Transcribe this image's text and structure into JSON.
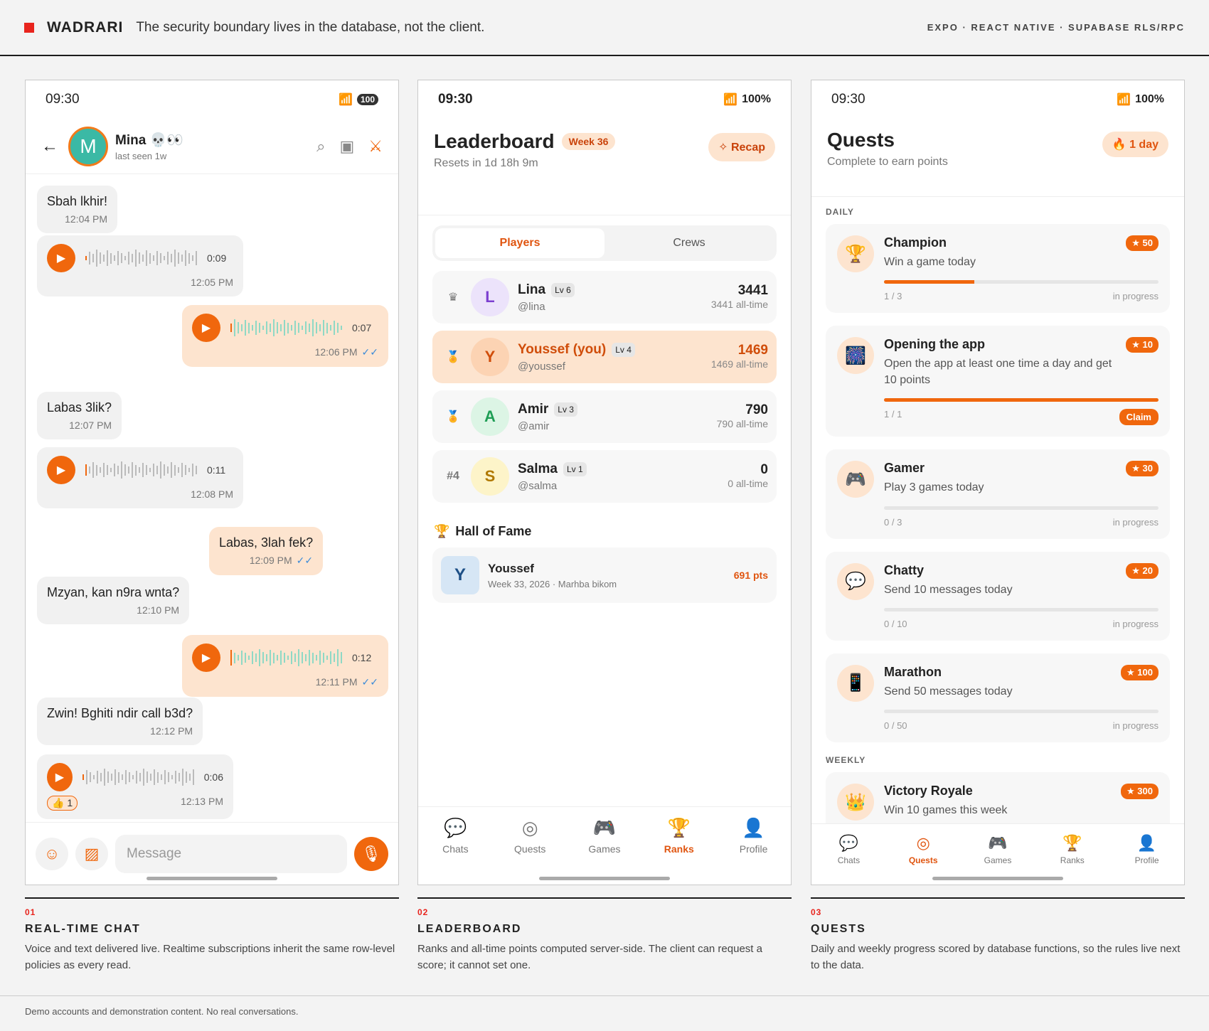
{
  "header": {
    "brand": "WADRARI",
    "tagline": "The security boundary lives in the database, not the client.",
    "stack": "EXPO · REACT NATIVE · SUPABASE RLS/RPC"
  },
  "chat": {
    "time": "09:30",
    "battery": "100",
    "contact_name": "Mina 💀👀",
    "contact_initial": "M",
    "last_seen": "last seen 1w",
    "input_placeholder": "Message",
    "messages": [
      {
        "text": "Sbah lkhir!",
        "time": "12:04 PM"
      },
      {
        "duration": "0:09",
        "time": "12:05 PM"
      },
      {
        "duration": "0:07",
        "time": "12:06 PM"
      },
      {
        "text": "Labas 3lik?",
        "time": "12:07 PM"
      },
      {
        "duration": "0:11",
        "time": "12:08 PM"
      },
      {
        "text": "Labas, 3lah fek?",
        "time": "12:09 PM"
      },
      {
        "text": "Mzyan, kan n9ra wnta?",
        "time": "12:10 PM"
      },
      {
        "duration": "0:12",
        "time": "12:11 PM"
      },
      {
        "text": "Zwin! Bghiti ndir call b3d?",
        "time": "12:12 PM"
      },
      {
        "duration": "0:06",
        "time": "12:13 PM",
        "reaction": "👍 1"
      }
    ]
  },
  "leaderboard": {
    "time": "09:30",
    "battery": "100%",
    "title": "Leaderboard",
    "week": "Week 36",
    "resets": "Resets in 1d 18h 9m",
    "recap": "Recap",
    "tabs": [
      "Players",
      "Crews"
    ],
    "rows": [
      {
        "rank": "",
        "name": "Lina",
        "level": "Lv 6",
        "handle": "@lina",
        "points": "3441",
        "alltime": "3441 all-time",
        "initial": "L"
      },
      {
        "rank": "",
        "name": "Youssef (you)",
        "level": "Lv 4",
        "handle": "@youssef",
        "points": "1469",
        "alltime": "1469 all-time",
        "initial": "Y"
      },
      {
        "rank": "",
        "name": "Amir",
        "level": "Lv 3",
        "handle": "@amir",
        "points": "790",
        "alltime": "790 all-time",
        "initial": "A"
      },
      {
        "rank": "#4",
        "name": "Salma",
        "level": "Lv 1",
        "handle": "@salma",
        "points": "0",
        "alltime": "0 all-time",
        "initial": "S"
      }
    ],
    "hof_title": "Hall of Fame",
    "hof": {
      "initial": "Y",
      "name": "Youssef",
      "meta": "Week 33, 2026 · Marhba bikom",
      "points": "691 pts"
    },
    "nav": [
      "Chats",
      "Quests",
      "Games",
      "Ranks",
      "Profile"
    ]
  },
  "quests": {
    "time": "09:30",
    "battery": "100%",
    "title": "Quests",
    "subtitle": "Complete to earn points",
    "streak": "1 day",
    "daily_label": "DAILY",
    "weekly_label": "WEEKLY",
    "items": [
      {
        "icon": "🏆",
        "name": "Champion",
        "desc": "Win a game today",
        "points": "50",
        "progress": "1 / 3",
        "status": "in progress",
        "fraction": 0.33
      },
      {
        "icon": "🎆",
        "name": "Opening the app",
        "desc": "Open the app at least one time a day and get 10 points",
        "points": "10",
        "progress": "1 / 1",
        "status": "Claim",
        "fraction": 1
      },
      {
        "icon": "🎮",
        "name": "Gamer",
        "desc": "Play 3 games today",
        "points": "30",
        "progress": "0 / 3",
        "status": "in progress",
        "fraction": 0
      },
      {
        "icon": "💬",
        "name": "Chatty",
        "desc": "Send 10 messages today",
        "points": "20",
        "progress": "0 / 10",
        "status": "in progress",
        "fraction": 0
      },
      {
        "icon": "📱",
        "name": "Marathon",
        "desc": "Send 50 messages today",
        "points": "100",
        "progress": "0 / 50",
        "status": "in progress",
        "fraction": 0
      },
      {
        "icon": "👑",
        "name": "Victory Royale",
        "desc": "Win 10 games this week",
        "points": "300"
      }
    ],
    "nav": [
      "Chats",
      "Quests",
      "Games",
      "Ranks",
      "Profile"
    ]
  },
  "captions": [
    {
      "num": "01",
      "title": "REAL-TIME CHAT",
      "text": "Voice and text delivered live. Realtime subscriptions inherit the same row-level policies as every read."
    },
    {
      "num": "02",
      "title": "LEADERBOARD",
      "text": "Ranks and all-time points computed server-side. The client can request a score; it cannot set one."
    },
    {
      "num": "03",
      "title": "QUESTS",
      "text": "Daily and weekly progress scored by database functions, so the rules live next to the data."
    }
  ],
  "footer": "Demo accounts and demonstration content. No real conversations."
}
